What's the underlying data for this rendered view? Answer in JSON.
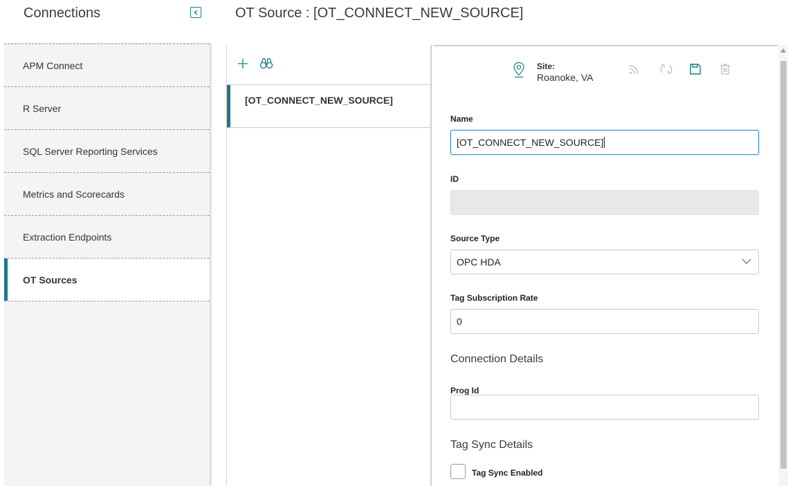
{
  "header": {
    "connections_title": "Connections",
    "page_title": "OT Source : [OT_CONNECT_NEW_SOURCE]"
  },
  "nav": {
    "items": [
      {
        "label": "APM Connect"
      },
      {
        "label": "R Server"
      },
      {
        "label": "SQL Server Reporting Services"
      },
      {
        "label": "Metrics and Scorecards"
      },
      {
        "label": "Extraction Endpoints"
      },
      {
        "label": "OT Sources"
      }
    ],
    "active_index": 5
  },
  "list": {
    "items": [
      {
        "label": "[OT_CONNECT_NEW_SOURCE]"
      }
    ]
  },
  "form": {
    "site_label": "Site:",
    "site_value": "Roanoke, VA",
    "name_label": "Name",
    "name_value": "[OT_CONNECT_NEW_SOURCE]",
    "id_label": "ID",
    "id_value": "",
    "source_type_label": "Source Type",
    "source_type_value": "OPC HDA",
    "tag_rate_label": "Tag Subscription Rate",
    "tag_rate_value": "0",
    "connection_details_heading": "Connection Details",
    "prog_id_label": "Prog Id",
    "prog_id_value": "",
    "tag_sync_heading": "Tag Sync Details",
    "tag_sync_enabled_label": "Tag Sync Enabled",
    "tag_sync_enabled": false
  },
  "colors": {
    "accent": "#1b7a86",
    "focus": "#3f8fd8",
    "disabled_icon": "#bdbdbd"
  }
}
